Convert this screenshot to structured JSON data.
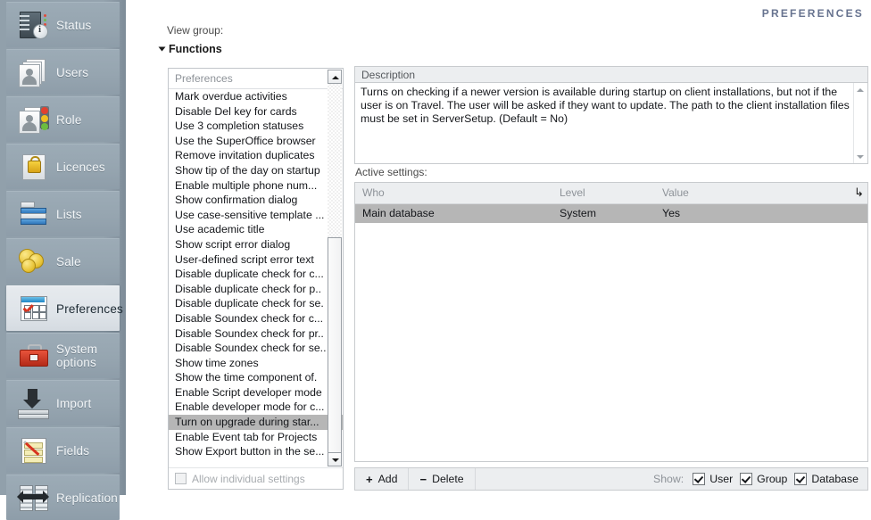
{
  "sidebar": {
    "items": [
      {
        "label": "Status",
        "icon": "server-status-icon",
        "active": false
      },
      {
        "label": "Users",
        "icon": "users-cards-icon",
        "active": false
      },
      {
        "label": "Role",
        "icon": "role-trafficlight-icon",
        "active": false
      },
      {
        "label": "Licences",
        "icon": "padlock-icon",
        "active": false
      },
      {
        "label": "Lists",
        "icon": "list-rows-icon",
        "active": false
      },
      {
        "label": "Sale",
        "icon": "coins-icon",
        "active": false
      },
      {
        "label": "Preferences",
        "icon": "preferences-calendar-icon",
        "active": true
      },
      {
        "label": "System options",
        "icon": "toolbox-icon",
        "active": false
      },
      {
        "label": "Import",
        "icon": "import-arrow-icon",
        "active": false
      },
      {
        "label": "Fields",
        "icon": "fields-pencil-icon",
        "active": false
      },
      {
        "label": "Replication",
        "icon": "replication-arrows-icon",
        "active": false
      }
    ]
  },
  "header": {
    "page_title": "PREFERENCES"
  },
  "viewgroup": {
    "label": "View group:",
    "group_name": "Functions",
    "expander_icon": "triangle-down-icon"
  },
  "list_panel": {
    "header_title": "Preferences",
    "sort_icon": "sort-arrow-icon",
    "scroll_up_icon": "scroll-up-arrow-icon",
    "scroll_down_icon": "scroll-down-arrow-icon",
    "items": [
      "Mark overdue activities",
      "Disable Del key for cards",
      "Use 3 completion statuses",
      "Use the SuperOffice browser",
      "Remove invitation duplicates",
      "Show tip of the day on startup",
      "Enable multiple phone num...",
      "Show confirmation dialog",
      "Use case-sensitive template ...",
      "Use academic title",
      "Show script error dialog",
      "User-defined script error text",
      "Disable duplicate check for c...",
      "Disable duplicate check for p..",
      "Disable duplicate check for se.",
      "Disable Soundex check for c...",
      "Disable Soundex check for pr..",
      "Disable Soundex check for se..",
      "Show time zones",
      "Show the time component of.",
      "Enable Script developer mode",
      "Enable developer mode for c...",
      "Turn on upgrade during star...",
      "Enable Event tab for Projects",
      "Show Export button in the se..."
    ],
    "selected_index": 22,
    "footer_checkbox_label": "Allow individual settings",
    "footer_checkbox_checked": false,
    "footer_checkbox_enabled": false
  },
  "description": {
    "header": "Description",
    "text": "Turns on checking if a newer version is available during startup on client installations, but not if the user is on Travel. The user will be asked if they want to update. The path to the client installation files must be set in ServerSetup. (Default = No)",
    "scroll_up_icon": "scroll-up-arrow-icon",
    "scroll_down_icon": "scroll-down-arrow-icon"
  },
  "active_settings": {
    "label": "Active settings:",
    "sort_icon": "sort-arrow-icon",
    "columns": [
      "Who",
      "Level",
      "Value"
    ],
    "rows": [
      {
        "who": "Main database",
        "level": "System",
        "value": "Yes",
        "selected": true
      }
    ]
  },
  "footer": {
    "add_label": "Add",
    "add_icon": "plus-icon",
    "delete_label": "Delete",
    "delete_icon": "minus-icon",
    "show_label": "Show:",
    "filters": [
      {
        "label": "User",
        "checked": true
      },
      {
        "label": "Group",
        "checked": true
      },
      {
        "label": "Database",
        "checked": true
      }
    ]
  },
  "colors": {
    "sidebar_bg": "#94a3ae",
    "sidebar_item_bg": "#96a5b0",
    "sidebar_active_bg": "#e0e5ea",
    "title_color": "#67738f",
    "selection_gray": "#b6b6b6",
    "panel_header_bg": "#eceef0"
  }
}
